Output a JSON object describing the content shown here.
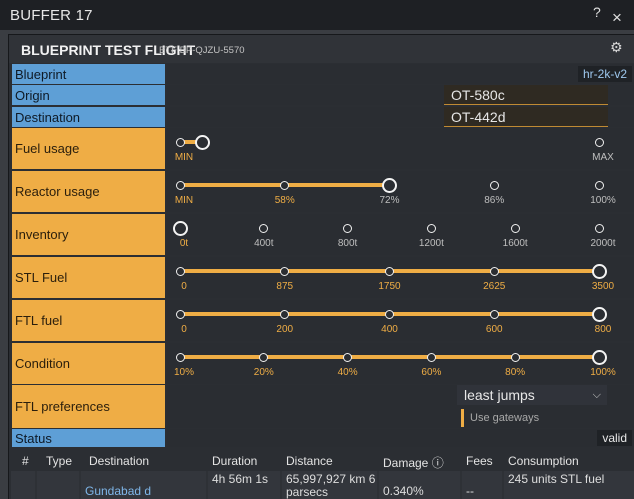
{
  "window": {
    "title": "BUFFER 17",
    "help_glyph": "?",
    "close_glyph": "×"
  },
  "panel": {
    "title": "BLUEPRINT TEST FLIGHT",
    "subtitle": "BTF BP-QJZU-5570",
    "gear_glyph": "⚙"
  },
  "blueprint": {
    "label": "Blueprint",
    "value": "hr-2k-v2"
  },
  "origin": {
    "label": "Origin",
    "value": "OT-580c"
  },
  "destination": {
    "label": "Destination",
    "value": "OT-442d"
  },
  "sliders": [
    {
      "label": "Fuel usage",
      "ticks": [
        "MIN",
        "",
        "",
        "",
        "MAX"
      ],
      "tick_state": [
        "on",
        "off",
        "off",
        "off",
        "off"
      ],
      "selected_index": 0,
      "fill_fraction": 0.05,
      "variant": "fuel",
      "ticks_show": [
        0,
        4
      ]
    },
    {
      "label": "Reactor usage",
      "ticks": [
        "MIN",
        "58%",
        "72%",
        "86%",
        "100%"
      ],
      "tick_state": [
        "on",
        "on",
        "off",
        "off",
        "off"
      ],
      "selected_index": 2,
      "fill_fraction": 0.5
    },
    {
      "label": "Inventory",
      "ticks": [
        "0t",
        "400t",
        "800t",
        "1200t",
        "1600t",
        "2000t"
      ],
      "tick_state": [
        "on",
        "off",
        "off",
        "off",
        "off",
        "off"
      ],
      "selected_index": 0,
      "fill_fraction": 0
    },
    {
      "label": "STL Fuel",
      "ticks": [
        "0",
        "875",
        "1750",
        "2625",
        "3500"
      ],
      "tick_state": [
        "on",
        "on",
        "on",
        "on",
        "on"
      ],
      "selected_index": 4,
      "fill_fraction": 1
    },
    {
      "label": "FTL fuel",
      "ticks": [
        "0",
        "200",
        "400",
        "600",
        "800"
      ],
      "tick_state": [
        "on",
        "on",
        "on",
        "on",
        "on"
      ],
      "selected_index": 4,
      "fill_fraction": 1
    },
    {
      "label": "Condition",
      "ticks": [
        "10%",
        "20%",
        "40%",
        "60%",
        "80%",
        "100%"
      ],
      "tick_state": [
        "on",
        "on",
        "on",
        "on",
        "on",
        "on"
      ],
      "selected_index": 5,
      "fill_fraction": 1
    }
  ],
  "ftl_preferences": {
    "label": "FTL preferences",
    "select_value": "least jumps",
    "checkbox_label": "Use gateways",
    "checked": false
  },
  "status": {
    "label": "Status",
    "value": "valid"
  },
  "table": {
    "columns": [
      "#",
      "Type",
      "Destination",
      "Duration",
      "Distance",
      "Damage ⓘ",
      "Fees",
      "Consumption"
    ],
    "rows": [
      {
        "num": "",
        "type": "",
        "destination": "Gundabad d",
        "duration": "4h 56m 1s",
        "distance": "65,997,927 km 6 parsecs",
        "damage": "0.340%",
        "fees": "--",
        "consumption": "245 units STL fuel"
      }
    ]
  },
  "colors": {
    "accent": "#efad45",
    "label_blue": "#5e9fd6",
    "link": "#7fb7ea",
    "background": "#2b2e33"
  }
}
